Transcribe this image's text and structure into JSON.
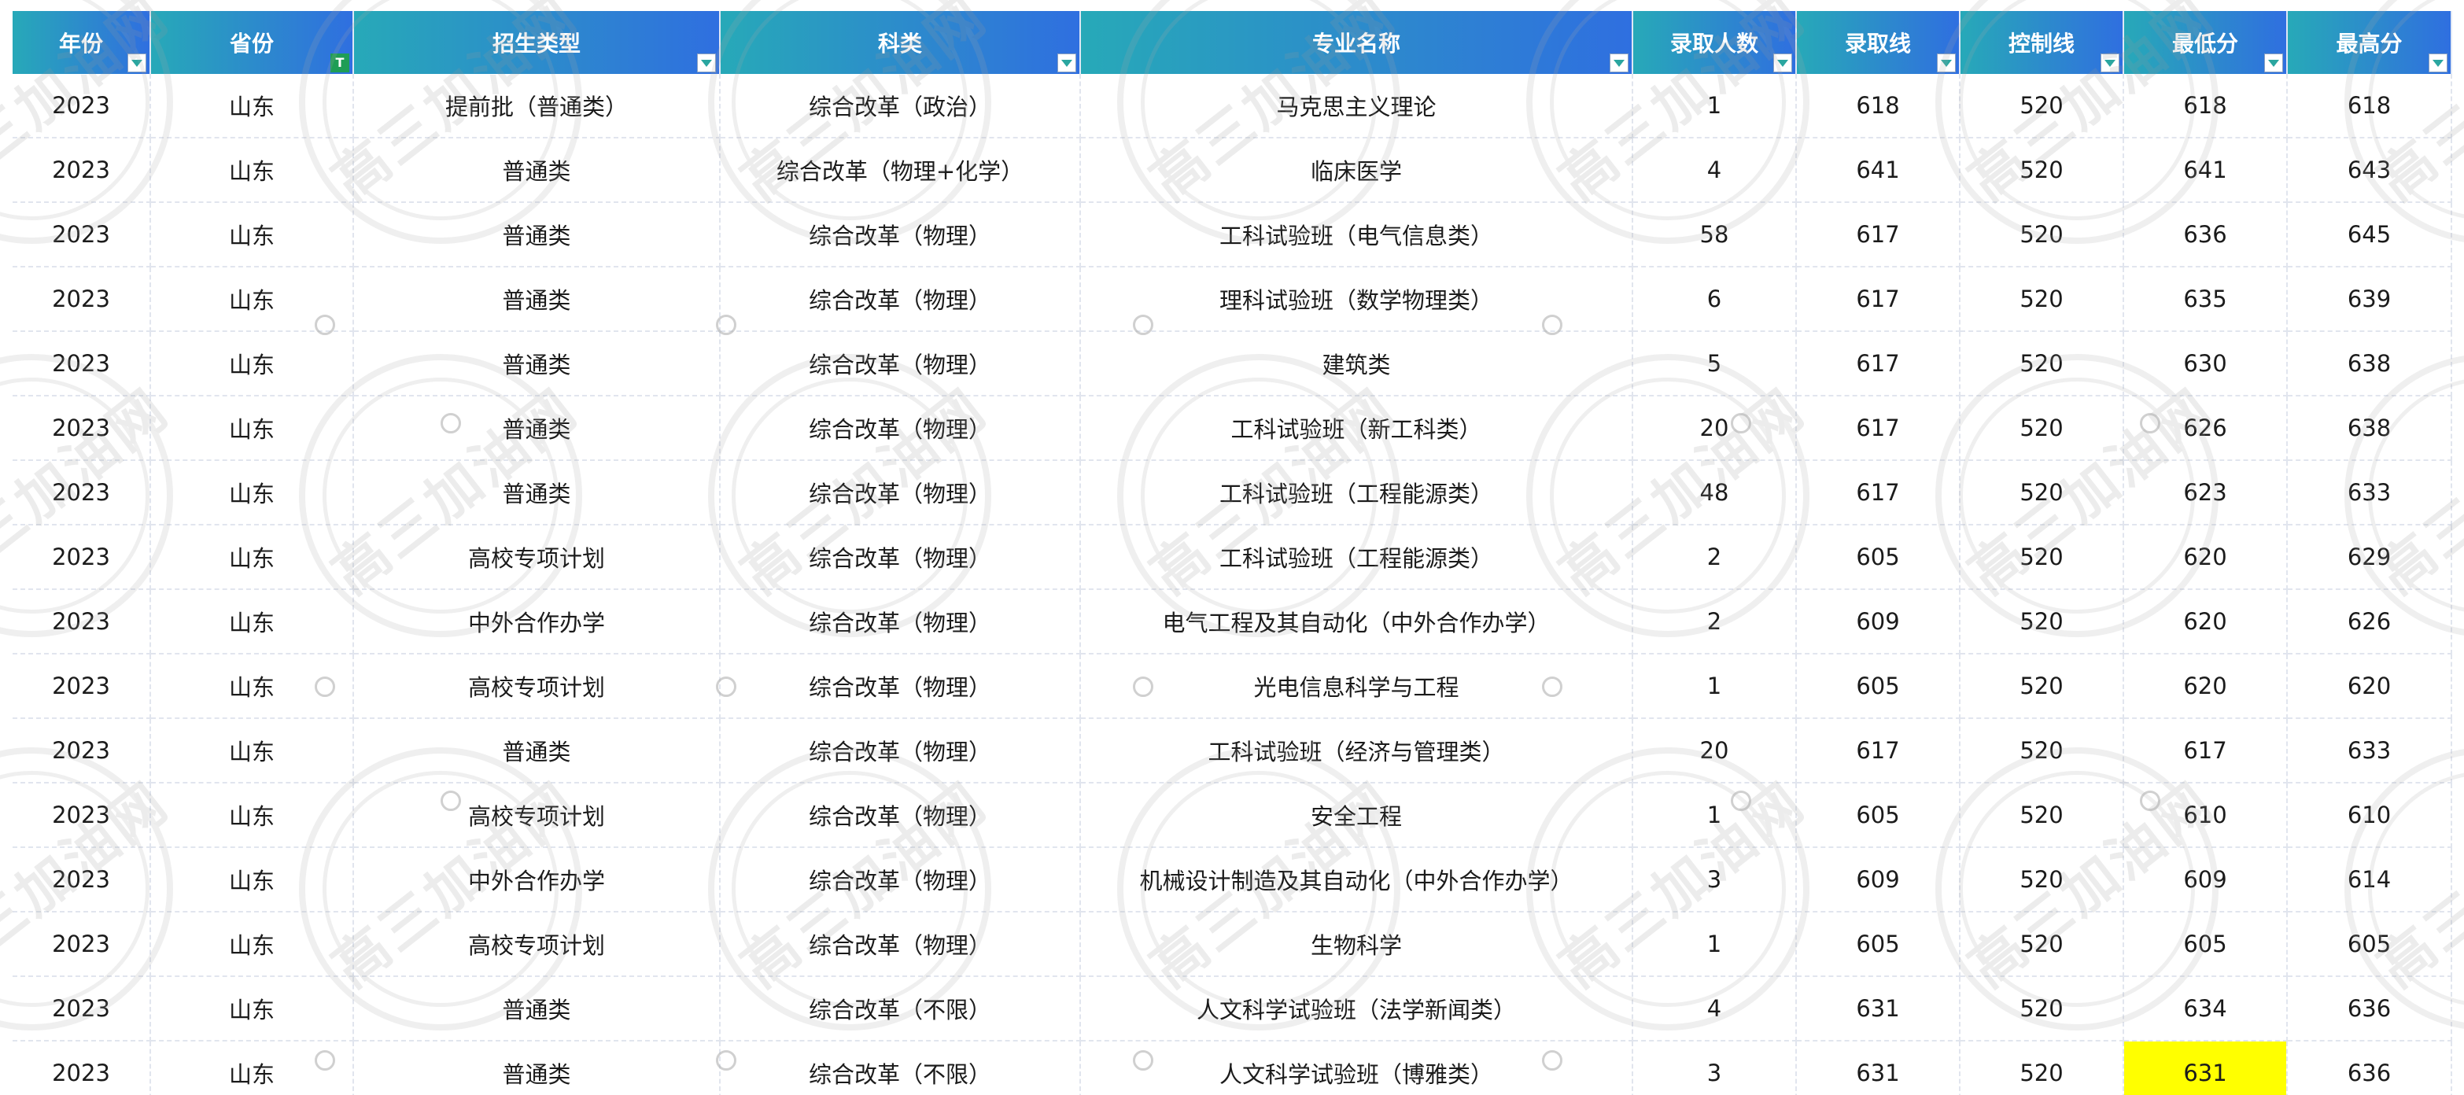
{
  "table": {
    "columns": [
      {
        "label": "年份",
        "filter": "dropdown"
      },
      {
        "label": "省份",
        "filter": "text"
      },
      {
        "label": "招生类型",
        "filter": "dropdown"
      },
      {
        "label": "科类",
        "filter": "dropdown"
      },
      {
        "label": "专业名称",
        "filter": "dropdown"
      },
      {
        "label": "录取人数",
        "filter": "dropdown"
      },
      {
        "label": "录取线",
        "filter": "dropdown"
      },
      {
        "label": "控制线",
        "filter": "dropdown"
      },
      {
        "label": "最低分",
        "filter": "dropdown"
      },
      {
        "label": "最高分",
        "filter": "dropdown"
      }
    ],
    "text_filter_badge": "T",
    "rows": [
      [
        "2023",
        "山东",
        "提前批（普通类）",
        "综合改革（政治）",
        "马克思主义理论",
        "1",
        "618",
        "520",
        "618",
        "618"
      ],
      [
        "2023",
        "山东",
        "普通类",
        "综合改革（物理+化学）",
        "临床医学",
        "4",
        "641",
        "520",
        "641",
        "643"
      ],
      [
        "2023",
        "山东",
        "普通类",
        "综合改革（物理）",
        "工科试验班（电气信息类）",
        "58",
        "617",
        "520",
        "636",
        "645"
      ],
      [
        "2023",
        "山东",
        "普通类",
        "综合改革（物理）",
        "理科试验班（数学物理类）",
        "6",
        "617",
        "520",
        "635",
        "639"
      ],
      [
        "2023",
        "山东",
        "普通类",
        "综合改革（物理）",
        "建筑类",
        "5",
        "617",
        "520",
        "630",
        "638"
      ],
      [
        "2023",
        "山东",
        "普通类",
        "综合改革（物理）",
        "工科试验班（新工科类）",
        "20",
        "617",
        "520",
        "626",
        "638"
      ],
      [
        "2023",
        "山东",
        "普通类",
        "综合改革（物理）",
        "工科试验班（工程能源类）",
        "48",
        "617",
        "520",
        "623",
        "633"
      ],
      [
        "2023",
        "山东",
        "高校专项计划",
        "综合改革（物理）",
        "工科试验班（工程能源类）",
        "2",
        "605",
        "520",
        "620",
        "629"
      ],
      [
        "2023",
        "山东",
        "中外合作办学",
        "综合改革（物理）",
        "电气工程及其自动化（中外合作办学）",
        "2",
        "609",
        "520",
        "620",
        "626"
      ],
      [
        "2023",
        "山东",
        "高校专项计划",
        "综合改革（物理）",
        "光电信息科学与工程",
        "1",
        "605",
        "520",
        "620",
        "620"
      ],
      [
        "2023",
        "山东",
        "普通类",
        "综合改革（物理）",
        "工科试验班（经济与管理类）",
        "20",
        "617",
        "520",
        "617",
        "633"
      ],
      [
        "2023",
        "山东",
        "高校专项计划",
        "综合改革（物理）",
        "安全工程",
        "1",
        "605",
        "520",
        "610",
        "610"
      ],
      [
        "2023",
        "山东",
        "中外合作办学",
        "综合改革（物理）",
        "机械设计制造及其自动化（中外合作办学）",
        "3",
        "609",
        "520",
        "609",
        "614"
      ],
      [
        "2023",
        "山东",
        "高校专项计划",
        "综合改革（物理）",
        "生物科学",
        "1",
        "605",
        "520",
        "605",
        "605"
      ],
      [
        "2023",
        "山东",
        "普通类",
        "综合改革（不限）",
        "人文科学试验班（法学新闻类）",
        "4",
        "631",
        "520",
        "634",
        "636"
      ],
      [
        "2023",
        "山东",
        "普通类",
        "综合改革（不限）",
        "人文科学试验班（博雅类）",
        "3",
        "631",
        "520",
        "631",
        "636"
      ]
    ],
    "highlight": {
      "row": 15,
      "col": 8,
      "color": "#ffff00"
    }
  },
  "watermark": {
    "text": "高三加油网"
  },
  "colors": {
    "header_start": "#27a9b8",
    "header_end": "#2f6fe0",
    "highlight": "#ffff00",
    "text_filter": "#1f9d55"
  }
}
